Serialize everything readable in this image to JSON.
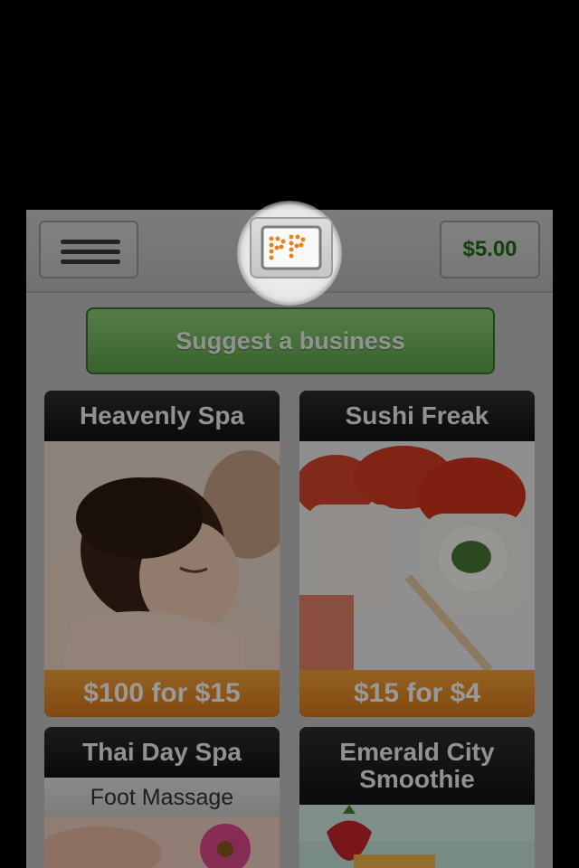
{
  "header": {
    "menu_icon": "hamburger-menu-icon",
    "logo_icon": "pp-logo-icon",
    "balance": "$5.00",
    "balance_color": "#1e6b12"
  },
  "suggest": {
    "label": "Suggest a business",
    "color": "#6fb85a"
  },
  "deals": [
    {
      "title": "Heavenly Spa",
      "price": "$100 for $15",
      "image": "spa-massage-photo"
    },
    {
      "title": "Sushi Freak",
      "price": "$15 for $4",
      "image": "sushi-rolls-photo"
    },
    {
      "title": "Thai Day Spa",
      "subtitle": "Foot Massage",
      "image": "foot-massage-photo"
    },
    {
      "title_line1": "Emerald City",
      "title_line2": "Smoothie",
      "image": "smoothie-photo"
    }
  ],
  "price_color": "#e88a24"
}
